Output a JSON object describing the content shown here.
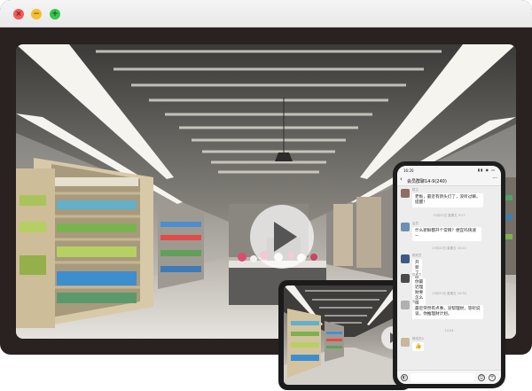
{
  "window": {
    "controls": {
      "close": "×",
      "minimize": "−",
      "zoom": "+"
    }
  },
  "video": {
    "play_icon": "play-icon"
  },
  "phone": {
    "status_time": "16:20",
    "status_icons": "▮▮ ◉ ▭",
    "chat_title": "会员群聊14-9(240)",
    "back_icon": "‹",
    "more_icon": "···",
    "messages": [
      {
        "sender": "群主",
        "text": "老板，最近有新头灯了，没听过嘛，提醒！",
        "avatar_color": "#8d6e63"
      },
      {
        "time": "13月22日 星期五 9:17"
      },
      {
        "sender": "会员",
        "text": "什么新鲜都开个常销？便宜吗快速~",
        "avatar_color": "#6d8fb3"
      },
      {
        "time": "13月22日 星期五 10:22"
      },
      {
        "sender": "群成员",
        "text": "开新了吗",
        "avatar_color": "#3f5a82"
      },
      {
        "sender": "群成员",
        "text": "你最近理财要怎么样呢？",
        "avatar_color": "#4a4a4a"
      },
      {
        "time": "13月22日 星期五 10:30"
      },
      {
        "sender": "客服",
        "text": "最近突然有点事，没帮理财，等听说谈，你推理财计划。",
        "avatar_color": "#b0b0b0"
      },
      {
        "time": "10:04"
      },
      {
        "sender": "群成员A",
        "text": "👍",
        "avatar_color": "#c9b79c"
      }
    ]
  },
  "colors": {
    "window_bg": "#2a2220",
    "titlebar": "#efefef",
    "close": "#f25b56",
    "minimize": "#f6be32",
    "zoom": "#3ac64b",
    "chat_bg": "#ededed"
  }
}
